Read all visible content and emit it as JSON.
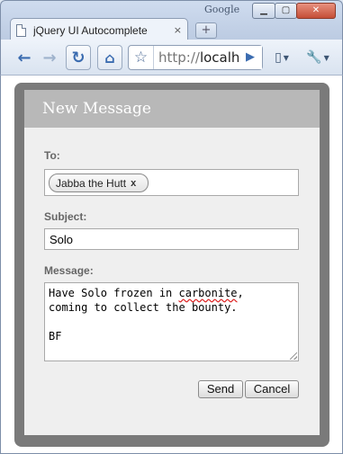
{
  "browser": {
    "brand_label": "Google",
    "tab_title": "jQuery UI Autocomplete",
    "tab_close": "×",
    "new_tab": "+",
    "url_scheme": "http://",
    "url_host": "localh",
    "window_controls": {
      "minimize": "▁",
      "maximize": "▢",
      "close": "✕"
    }
  },
  "dialog": {
    "title": "New Message",
    "to_label": "To:",
    "recipients": [
      {
        "name": "Jabba the Hutt",
        "remove": "x"
      }
    ],
    "subject_label": "Subject:",
    "subject_value": "Solo",
    "message_label": "Message:",
    "message_lines": [
      {
        "before": "Have Solo frozen in ",
        "misspelled": "carbonite",
        "after": ","
      },
      "coming to collect the bounty.",
      "",
      "BF"
    ],
    "send_label": "Send",
    "cancel_label": "Cancel"
  }
}
